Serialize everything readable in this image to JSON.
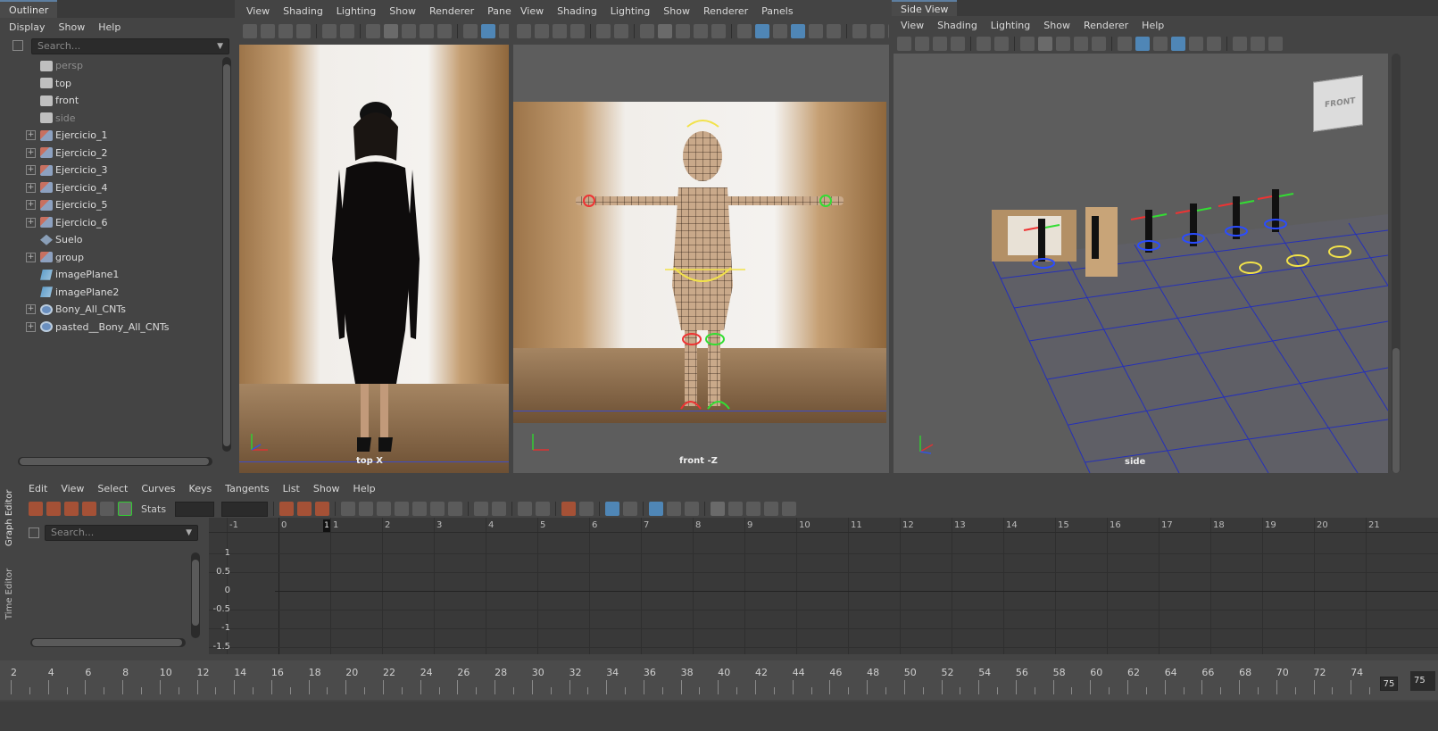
{
  "outliner": {
    "tab_title": "Outliner",
    "menu": [
      "Display",
      "Show",
      "Help"
    ],
    "search_placeholder": "Search...",
    "items": [
      {
        "label": "persp",
        "type": "camera",
        "dim": true,
        "expandable": false
      },
      {
        "label": "top",
        "type": "camera",
        "dim": false,
        "expandable": false
      },
      {
        "label": "front",
        "type": "camera",
        "dim": false,
        "expandable": false
      },
      {
        "label": "side",
        "type": "camera",
        "dim": true,
        "expandable": false
      },
      {
        "label": "Ejercicio_1",
        "type": "transform",
        "dim": false,
        "expandable": true
      },
      {
        "label": "Ejercicio_2",
        "type": "transform",
        "dim": false,
        "expandable": true
      },
      {
        "label": "Ejercicio_3",
        "type": "transform",
        "dim": false,
        "expandable": true
      },
      {
        "label": "Ejercicio_4",
        "type": "transform",
        "dim": false,
        "expandable": true
      },
      {
        "label": "Ejercicio_5",
        "type": "transform",
        "dim": false,
        "expandable": true
      },
      {
        "label": "Ejercicio_6",
        "type": "transform",
        "dim": false,
        "expandable": true
      },
      {
        "label": "Suelo",
        "type": "mesh",
        "dim": false,
        "expandable": false
      },
      {
        "label": "group",
        "type": "transform",
        "dim": false,
        "expandable": true
      },
      {
        "label": "imagePlane1",
        "type": "imageplane",
        "dim": false,
        "expandable": false
      },
      {
        "label": "imagePlane2",
        "type": "imageplane",
        "dim": false,
        "expandable": false
      },
      {
        "label": "Bony_All_CNTs",
        "type": "control",
        "dim": false,
        "expandable": true
      },
      {
        "label": "pasted__Bony_All_CNTs",
        "type": "control",
        "dim": false,
        "expandable": true
      }
    ]
  },
  "viewport_menu": [
    "View",
    "Shading",
    "Lighting",
    "Show",
    "Renderer",
    "Panels"
  ],
  "viewport_top": {
    "label": "top X"
  },
  "viewport_front": {
    "label": "front -Z"
  },
  "side_view": {
    "tab_title": "Side View",
    "menu": [
      "View",
      "Shading",
      "Lighting",
      "Show",
      "Renderer",
      "Help"
    ],
    "label": "side",
    "viewcube_label": "FRONT"
  },
  "graph_editor": {
    "side_tabs": [
      "Graph Editor",
      "Time Editor"
    ],
    "menu": [
      "Edit",
      "View",
      "Select",
      "Curves",
      "Keys",
      "Tangents",
      "List",
      "Show",
      "Help"
    ],
    "stats_label": "Stats",
    "search_placeholder": "Search...",
    "frames": [
      "-1",
      "0",
      "1",
      "2",
      "3",
      "4",
      "5",
      "6",
      "7",
      "8",
      "9",
      "10",
      "11",
      "12",
      "13",
      "14",
      "15",
      "16",
      "17",
      "18",
      "19",
      "20",
      "21"
    ],
    "current_frame_marker": "1",
    "y_values": [
      "1",
      "0.5",
      "0",
      "-0.5",
      "-1",
      "-1.5"
    ]
  },
  "timeline": {
    "frames": [
      "2",
      "4",
      "6",
      "8",
      "10",
      "12",
      "14",
      "16",
      "18",
      "20",
      "22",
      "24",
      "26",
      "28",
      "30",
      "32",
      "34",
      "36",
      "38",
      "40",
      "42",
      "44",
      "46",
      "48",
      "50",
      "52",
      "54",
      "56",
      "58",
      "60",
      "62",
      "64",
      "66",
      "68",
      "70",
      "72",
      "74"
    ],
    "end_frame": "75",
    "end_field": "75"
  },
  "colors": {
    "accent": "#5d7ea0",
    "key_blue": "#4f86b6",
    "panel": "#444444"
  }
}
